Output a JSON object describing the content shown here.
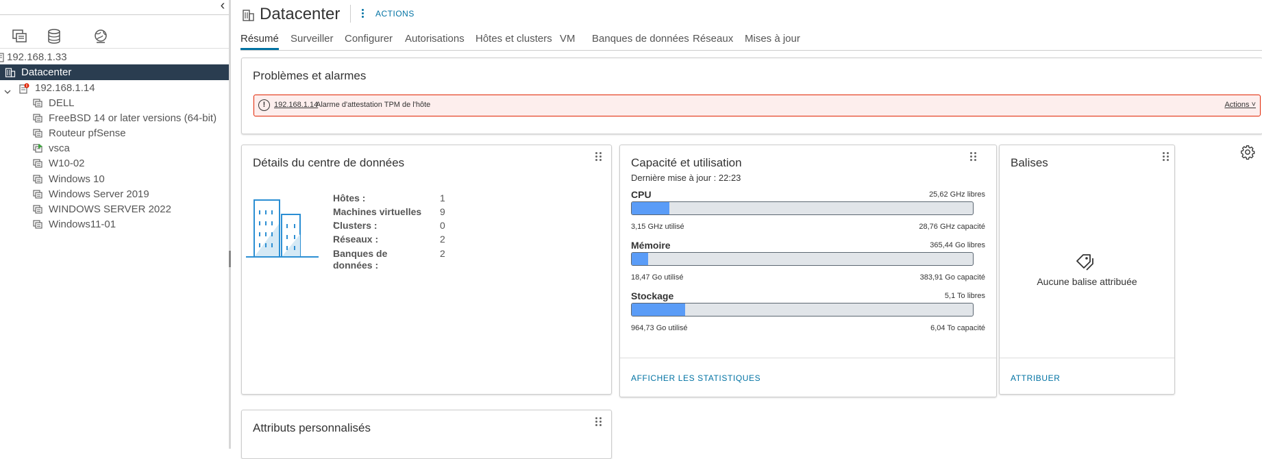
{
  "sidebar": {
    "collapse_label": "‹",
    "nav_tabs": [
      {
        "icon": "hosts-clusters-icon"
      },
      {
        "icon": "storage-icon"
      },
      {
        "icon": "networking-icon"
      }
    ],
    "tree": [
      {
        "label": "192.168.1.33",
        "icon": "vcenter-icon"
      },
      {
        "label": "Datacenter",
        "icon": "datacenter-icon",
        "selected": true
      },
      {
        "label": "192.168.1.14",
        "icon": "host-alert-icon",
        "expanded": true
      },
      {
        "label": "DELL",
        "icon": "vm-icon"
      },
      {
        "label": "FreeBSD 14 or later versions (64-bit)",
        "icon": "vm-icon"
      },
      {
        "label": "Routeur pfSense",
        "icon": "vm-icon"
      },
      {
        "label": "vsca",
        "icon": "vm-running-icon"
      },
      {
        "label": "W10-02",
        "icon": "vm-icon"
      },
      {
        "label": "Windows 10",
        "icon": "vm-icon"
      },
      {
        "label": "Windows Server 2019",
        "icon": "vm-icon"
      },
      {
        "label": "WINDOWS SERVER 2022",
        "icon": "vm-icon"
      },
      {
        "label": "Windows11-01",
        "icon": "vm-icon"
      }
    ]
  },
  "header": {
    "title": "Datacenter",
    "actions_label": "ACTIONS",
    "tabs": [
      "Résumé",
      "Surveiller",
      "Configurer",
      "Autorisations",
      "Hôtes et clusters",
      "VM",
      "Banques de données",
      "Réseaux",
      "Mises à jour"
    ],
    "active_tab": "Résumé"
  },
  "alarms": {
    "title": "Problèmes et alarmes",
    "item": {
      "host": "192.168.1.14",
      "text": "Alarme d'attestation TPM de l'hôte",
      "actions_label": "Actions ˅"
    },
    "alert_color": "#e12200"
  },
  "details": {
    "title": "Détails du centre de données",
    "rows": [
      {
        "label": "Hôtes :",
        "value": "1"
      },
      {
        "label": "Machines virtuelles :",
        "value": "9"
      },
      {
        "label": "Clusters :",
        "value": "0"
      },
      {
        "label": "Réseaux :",
        "value": "2"
      },
      {
        "label": "Banques de données :",
        "value": "2"
      }
    ]
  },
  "capacity": {
    "title": "Capacité et utilisation",
    "subtitle": "Dernière mise à jour : 22:23",
    "resources": [
      {
        "name": "CPU",
        "free": "25,62 GHz libres",
        "used": "3,15 GHz utilisé",
        "total": "28,76 GHz capacité",
        "fraction": 0.11
      },
      {
        "name": "Mémoire",
        "free": "365,44 Go libres",
        "used": "18,47 Go utilisé",
        "total": "383,91 Go capacité",
        "fraction": 0.048
      },
      {
        "name": "Stockage",
        "free": "5,1 To libres",
        "used": "964,73 Go utilisé",
        "total": "6,04 To capacité",
        "fraction": 0.156
      }
    ],
    "link": "AFFICHER LES STATISTIQUES",
    "bar_color": "#5a9cf7"
  },
  "tags": {
    "title": "Balises",
    "empty_text": "Aucune balise attribuée",
    "link": "ATTRIBUER"
  },
  "attributes": {
    "title": "Attributs personnalisés"
  },
  "colors": {
    "accent": "#0072a3",
    "selected_row": "#2a3d50"
  }
}
